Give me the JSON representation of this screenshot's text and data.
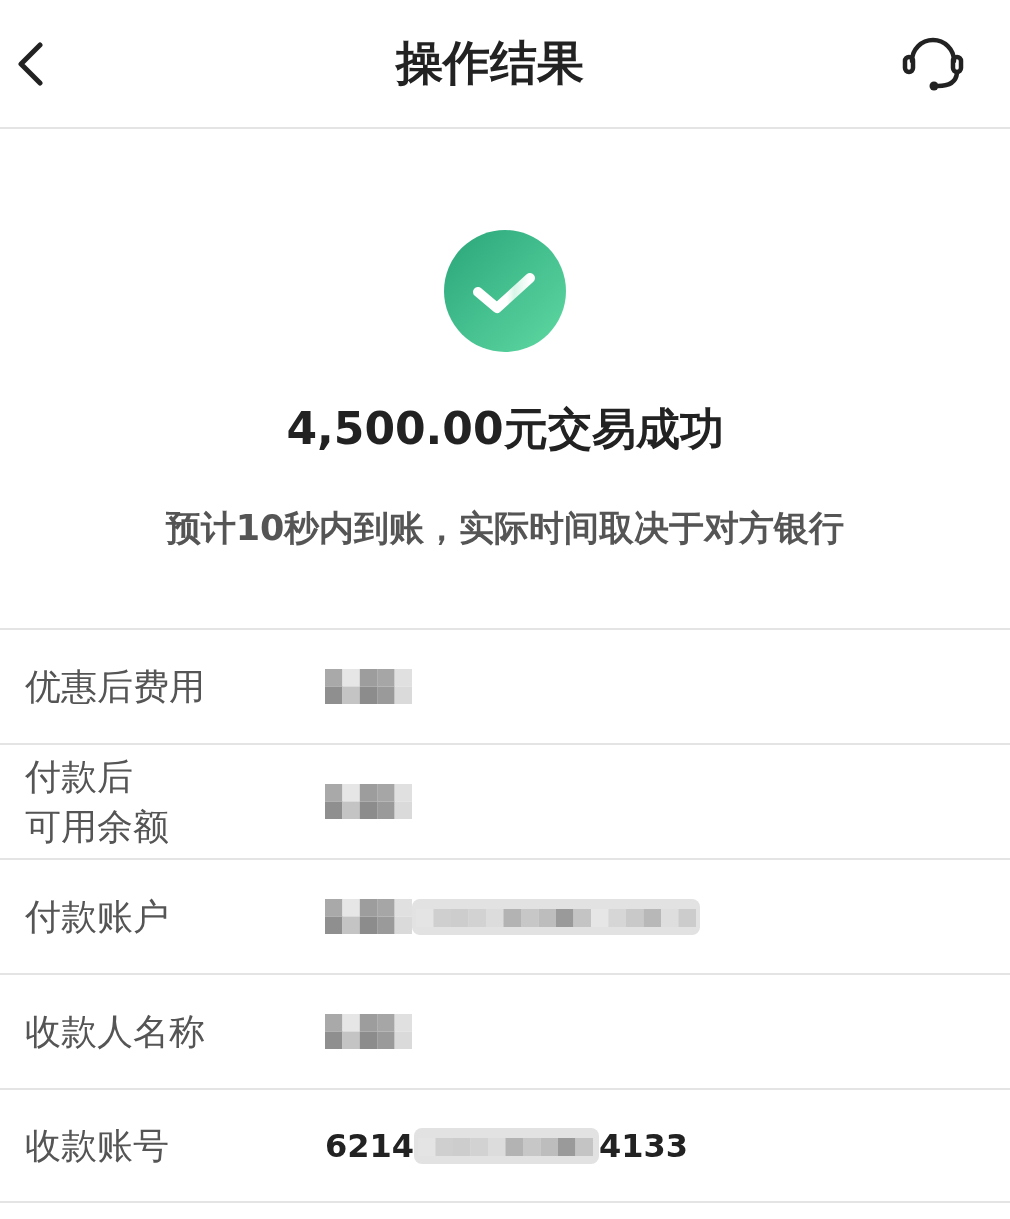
{
  "header": {
    "title": "操作结果"
  },
  "result": {
    "succeeded": true,
    "amount_text": "4,500.00元交易成功",
    "note": "预计10秒内到账，实际时间取决于对方银行"
  },
  "details": [
    {
      "label_lines": [
        "优惠后费用"
      ],
      "value": [
        {
          "kind": "mosaic"
        }
      ]
    },
    {
      "label_lines": [
        "付款后",
        "可用余额"
      ],
      "value": [
        {
          "kind": "mosaic"
        }
      ]
    },
    {
      "label_lines": [
        "付款账户"
      ],
      "value": [
        {
          "kind": "mosaic"
        },
        {
          "kind": "smear"
        }
      ]
    },
    {
      "label_lines": [
        "收款人名称"
      ],
      "value": [
        {
          "kind": "mosaic"
        }
      ]
    },
    {
      "label_lines": [
        "收款账号"
      ],
      "value": [
        {
          "kind": "text",
          "text": "6214"
        },
        {
          "kind": "smear"
        },
        {
          "kind": "text",
          "text": "4133"
        }
      ]
    }
  ]
}
